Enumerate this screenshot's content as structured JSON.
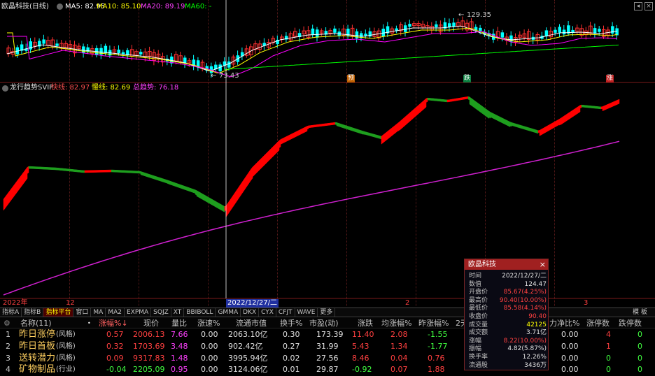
{
  "main_chart": {
    "title": "欧晶科技(日线)",
    "ma5": "MA5: 82.95",
    "ma10": "MA10: 85.10",
    "ma20": "MA20: 89.19",
    "ma60": "MA60: -",
    "high_label": "129.35",
    "low_label": "73.43",
    "markers": [
      "预",
      "跌",
      "涨"
    ],
    "colors": {
      "ma5": "#ffffff",
      "ma10": "#ffff00",
      "ma20": "#ff00ff",
      "ma60": "#00ff00",
      "up": "#ff3030",
      "down": "#00ffff"
    }
  },
  "indicator": {
    "title": "龙行趋势SVIP",
    "fast": "快线: 82.97",
    "slow": "慢线: 82.69",
    "total": "总趋势: 76.18",
    "colors": {
      "bull": "#ff0000",
      "bear": "#1e9e1e",
      "trend": "#d020d0"
    }
  },
  "time_axis": {
    "labels": [
      "2022年",
      "12",
      "2",
      "3"
    ],
    "cursor_date": "2022/12/27/二"
  },
  "tabs": [
    "指标A",
    "指标B",
    "指标平台",
    "窗口",
    "MA",
    "MA2",
    "EXPMA",
    "SQJZ",
    "XT",
    "BBIBOLL",
    "GMMA",
    "DKX",
    "CYX",
    "CFJT",
    "WAVE",
    "更多"
  ],
  "tab_template": "模 板",
  "table": {
    "headers": [
      "名称(11)",
      "涨幅%↓",
      "现价",
      "量比",
      "涨速%",
      "流通市值",
      "换手%",
      "市盈(动)",
      "涨跌",
      "均涨幅%",
      "昨涨幅%",
      "2天",
      "力净比%",
      "涨停数",
      "跌停数"
    ],
    "rows": [
      {
        "no": "1",
        "name": "昨日涨停",
        "tag": "(风格)",
        "chg": "0.57",
        "price": "2006.13",
        "vr": "7.66",
        "speed": "0.00",
        "mcap": "2063.10亿",
        "turn": "0.30",
        "pe": "173.39",
        "updown": "11.40",
        "avg": "2.08",
        "yest": "-1.55",
        "net": "0.00",
        "up": "4",
        "down": "0"
      },
      {
        "no": "2",
        "name": "昨日首板",
        "tag": "(风格)",
        "chg": "0.32",
        "price": "1703.69",
        "vr": "3.48",
        "speed": "0.00",
        "mcap": "902.42亿",
        "turn": "0.27",
        "pe": "31.99",
        "updown": "5.43",
        "avg": "1.34",
        "yest": "-1.77",
        "net": "0.00",
        "up": "1",
        "down": "0"
      },
      {
        "no": "3",
        "name": "送转潜力",
        "tag": "(风格)",
        "chg": "0.09",
        "price": "9317.83",
        "vr": "1.48",
        "speed": "0.00",
        "mcap": "3995.94亿",
        "turn": "0.02",
        "pe": "27.56",
        "updown": "8.46",
        "avg": "0.04",
        "yest": "0.76",
        "net": "0.00",
        "up": "0",
        "down": "0"
      },
      {
        "no": "4",
        "name": "矿物制品",
        "tag": "(行业)",
        "chg": "-0.04",
        "price": "2205.09",
        "vr": "0.95",
        "speed": "0.00",
        "mcap": "3124.06亿",
        "turn": "0.01",
        "pe": "29.87",
        "updown": "-0.92",
        "avg": "0.07",
        "yest": "1.88",
        "net": "0.00",
        "up": "0",
        "down": "0"
      }
    ]
  },
  "popup": {
    "title": "欧晶科技",
    "rows": [
      {
        "k": "时间",
        "v": "2022/12/27/二",
        "c": "#e0e0e0"
      },
      {
        "k": "数值",
        "v": "124.47",
        "c": "#e0e0e0"
      },
      {
        "k": "开盘价",
        "v": "85.67(4.25%)",
        "c": "#ff4040"
      },
      {
        "k": "最高价",
        "v": "90.40(10.00%)",
        "c": "#ff4040"
      },
      {
        "k": "最低价",
        "v": "85.58(4.14%)",
        "c": "#ff4040"
      },
      {
        "k": "收盘价",
        "v": "90.40",
        "c": "#ff4040"
      },
      {
        "k": "成交量",
        "v": "42125",
        "c": "#ffff00"
      },
      {
        "k": "成交额",
        "v": "3.71亿",
        "c": "#e0e0e0"
      },
      {
        "k": "涨幅",
        "v": "8.22(10.00%)",
        "c": "#ff4040"
      },
      {
        "k": "振幅",
        "v": "4.82(5.87%)",
        "c": "#e0e0e0"
      },
      {
        "k": "换手率",
        "v": "12.26%",
        "c": "#e0e0e0"
      },
      {
        "k": "流通股",
        "v": "3436万",
        "c": "#e0e0e0"
      }
    ]
  }
}
